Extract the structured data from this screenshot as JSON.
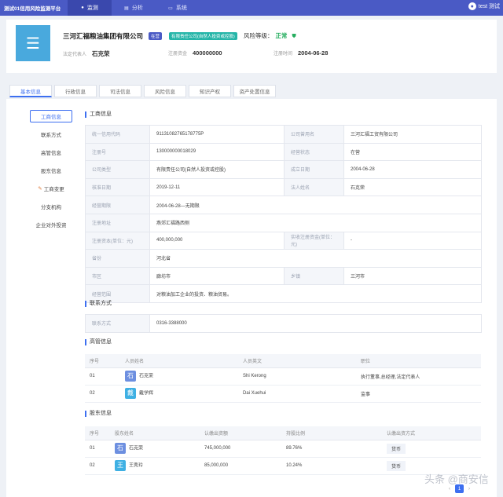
{
  "app": {
    "brand": "测试01信用风险监测平台",
    "nav": [
      "监测",
      "分析",
      "系统"
    ],
    "user": "test 测试"
  },
  "company": {
    "logo_glyph": "☰",
    "name": "三河汇福粮油集团有限公司",
    "status_tag": "在营",
    "type_tag": "有限责任公司(自然人投资或控股)",
    "risk_label": "风险等级：",
    "risk_value": "正常",
    "legal_label": "法定代表人",
    "legal_value": "石克荣",
    "capital_label": "注册资金",
    "capital_value": "400000000",
    "date_label": "注册时间",
    "date_value": "2004-06-28"
  },
  "tabs": [
    "基本信息",
    "行政信息",
    "司法信息",
    "风险信息",
    "知识产权",
    "资产处置信息"
  ],
  "side": [
    "工商信息",
    "联系方式",
    "高管信息",
    "股东信息",
    "工商变更",
    "分支机构",
    "企业对外投资"
  ],
  "sections": {
    "business": "工商信息",
    "contact": "联系方式",
    "execs": "高管信息",
    "holders": "股东信息"
  },
  "business_info": [
    [
      "统一信用代码",
      "91131082765178775P",
      "公司曾用名",
      "三河汇福工贸有限公司"
    ],
    [
      "注册号",
      "130000000018029",
      "经营状态",
      "在营"
    ],
    [
      "公司类型",
      "有限责任公司(自然人投资或控股)",
      "成立日期",
      "2004-06-28"
    ],
    [
      "核准日期",
      "2019-12-11",
      "法人姓名",
      "石克荣"
    ],
    [
      "经营期限",
      "2004-06-28—无期限",
      "",
      ""
    ],
    [
      "注册地址",
      "燕郊汇福路西侧",
      "",
      ""
    ],
    [
      "注册资本(单位：元)",
      "400,000,000",
      "实收注册资金(单位：元)",
      "-"
    ],
    [
      "省份",
      "河北省",
      "",
      ""
    ],
    [
      "市区",
      "廊坊市",
      "乡镇",
      "三河市"
    ],
    [
      "经营范围",
      "对粮油加工企业的投资、粮油贸易。",
      "",
      ""
    ]
  ],
  "contact": {
    "label": "联系方式",
    "value": "0316-3388000"
  },
  "execs": {
    "headers": [
      "序号",
      "人员姓名",
      "人员英文",
      "职位"
    ],
    "rows": [
      {
        "no": "01",
        "chip": "石",
        "name": "石克荣",
        "en": "Shi Kerong",
        "pos": "执行董事,总经理,法定代表人"
      },
      {
        "no": "02",
        "chip": "戴",
        "name": "戴学辉",
        "en": "Dai Xuehui",
        "pos": "监事"
      }
    ]
  },
  "holders": {
    "headers": [
      "序号",
      "股东姓名",
      "认缴出资额",
      "持股比例",
      "认缴出资方式"
    ],
    "rows": [
      {
        "no": "01",
        "chip": "石",
        "name": "石克荣",
        "amount": "745,000,000",
        "ratio": "89.76%",
        "method": "货币"
      },
      {
        "no": "02",
        "chip": "王",
        "name": "王秀玲",
        "amount": "85,000,000",
        "ratio": "10.24%",
        "method": "货币"
      }
    ]
  },
  "pager": {
    "prev": "‹",
    "page": "1",
    "next": "›"
  },
  "watermark": "头条 @商安信"
}
